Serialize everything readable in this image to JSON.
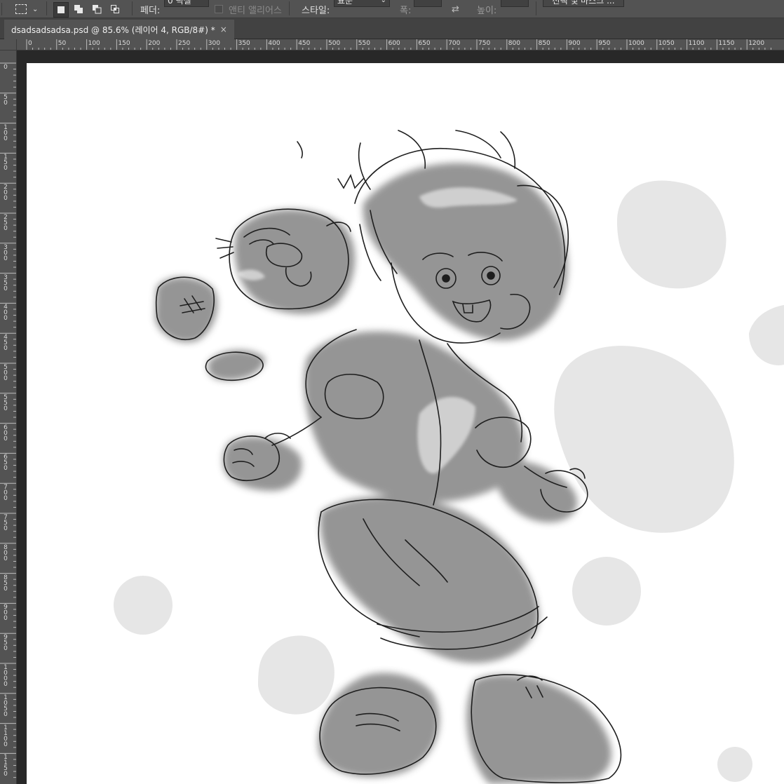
{
  "options_bar": {
    "feather_label": "페더:",
    "feather_value": "0 픽셀",
    "antialias_label": "앤티 앨리어스",
    "style_label": "스타일:",
    "style_value": "표준",
    "width_label": "폭:",
    "height_label": "높이:",
    "select_mask_label": "선택 및 마스크 ..."
  },
  "document_tab": {
    "title": "dsadsadsadsa.psd @ 85.6% (레이어 4, RGB/8#) *",
    "close_glyph": "×"
  },
  "rulers": {
    "horizontal": [
      "0",
      "50",
      "100",
      "150",
      "200",
      "250",
      "300",
      "350",
      "400",
      "450",
      "500",
      "550",
      "600",
      "650",
      "700",
      "750",
      "800",
      "850",
      "900",
      "950",
      "1000",
      "1050",
      "1100",
      "1150",
      "1200"
    ],
    "vertical": [
      "0",
      "50",
      "100",
      "150",
      "200",
      "250",
      "300",
      "350",
      "400",
      "450",
      "500",
      "550",
      "600",
      "650",
      "700",
      "750",
      "800",
      "850",
      "900",
      "950",
      "1000",
      "1050",
      "1100",
      "1150"
    ]
  },
  "canvas": {
    "content": "grayscale sketch: boy with freckles, beaver on shoulder, gray background blobs",
    "background_color": "#ffffff",
    "blob_color": "#e6e6e6"
  },
  "colors": {
    "app_bg": "#282828",
    "panel": "#535353",
    "tab_bar": "#424242"
  }
}
